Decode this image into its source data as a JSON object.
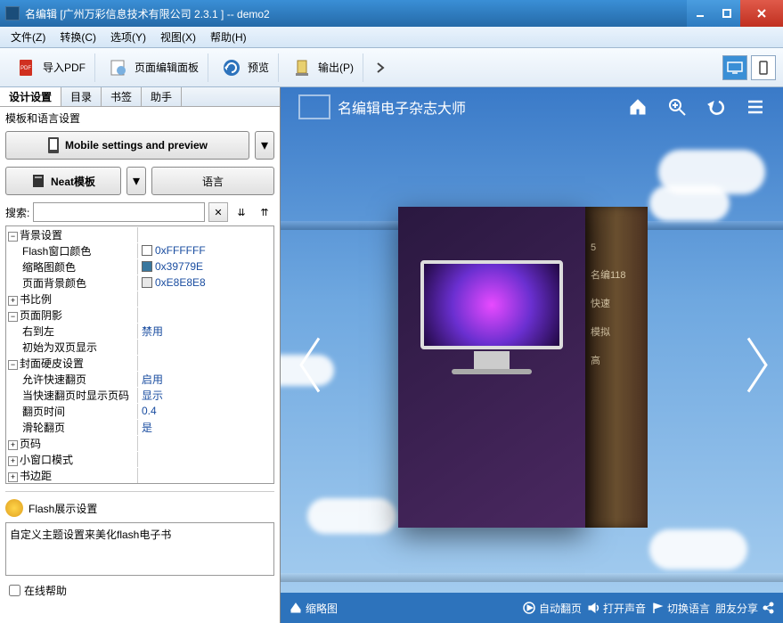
{
  "window": {
    "title": "名编辑 [广州万彩信息技术有限公司 2.3.1 ] -- demo2"
  },
  "menu": {
    "file": "文件(Z)",
    "convert": "转换(C)",
    "options": "选项(Y)",
    "view": "视图(X)",
    "help": "帮助(H)"
  },
  "toolbar": {
    "import_pdf": "导入PDF",
    "edit_panel": "页面编辑面板",
    "preview": "预览",
    "export": "输出(P)"
  },
  "tabs": {
    "design": "设计设置",
    "toc": "目录",
    "bookmark": "书签",
    "assistant": "助手"
  },
  "template_group": {
    "label": "模板和语言设置",
    "mobile_btn": "Mobile settings and preview",
    "neat_btn": "Neat模板",
    "lang_btn": "语言"
  },
  "search": {
    "label": "搜索:",
    "value": ""
  },
  "props": {
    "bg_settings": "背景设置",
    "flash_color": "Flash窗口颜色",
    "flash_color_val": "0xFFFFFF",
    "thumb_color": "缩略图颜色",
    "thumb_color_val": "0x39779E",
    "page_bg_color": "页面背景颜色",
    "page_bg_color_val": "0xE8E8E8",
    "book_ratio": "书比例",
    "page_shadow": "页面阴影",
    "rtl": "右到左",
    "rtl_val": "禁用",
    "initial_spread": "初始为双页显示",
    "hardcover": "封面硬皮设置",
    "fast_flip": "允许快速翻页",
    "fast_flip_val": "启用",
    "show_pagenum": "当快速翻页时显示页码",
    "show_pagenum_val": "显示",
    "flip_time": "翻页时间",
    "flip_time_val": "0.4",
    "wheel_flip": "滑轮翻页",
    "wheel_flip_val": "是",
    "page_number": "页码",
    "small_window": "小窗口模式",
    "book_margin": "书边距"
  },
  "flash_section": {
    "header": "Flash展示设置",
    "desc": "自定义主题设置来美化flash电子书",
    "online_help": "在线帮助"
  },
  "preview": {
    "brand": "名编辑电子杂志大师",
    "spine1": "5",
    "spine2": "名编118",
    "spine3": "快速",
    "spine4": "模拟",
    "spine5": "高"
  },
  "bottom": {
    "thumbs": "缩略图",
    "auto_flip": "自动翻页",
    "sound": "打开声音",
    "lang": "切换语言",
    "share": "朋友分享"
  },
  "colors": {
    "flash_window": "#FFFFFF",
    "thumbnail": "#39779E",
    "page_bg": "#E8E8E8"
  }
}
